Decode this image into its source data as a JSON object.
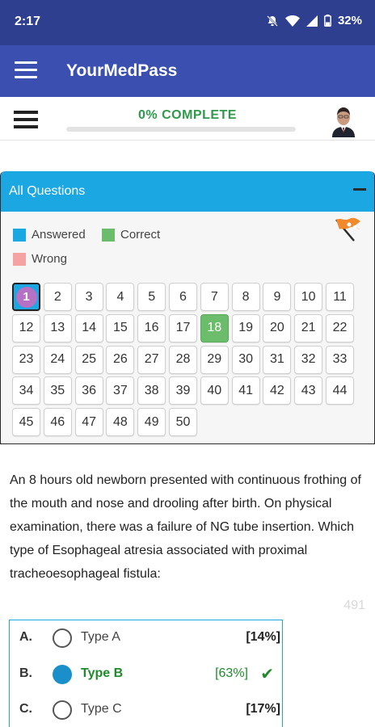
{
  "status_bar": {
    "time": "2:17",
    "battery": "32%",
    "icons": [
      "bell-off-icon",
      "wifi-icon",
      "signal-icon",
      "battery-icon"
    ]
  },
  "app_bar": {
    "title": "YourMedPass"
  },
  "progress": {
    "label": "0% COMPLETE",
    "fraction": 0
  },
  "panel": {
    "title": "All Questions"
  },
  "legend": [
    {
      "label": "Answered",
      "color": "#1aa7e2"
    },
    {
      "label": "Correct",
      "color": "#6bbd6b"
    },
    {
      "label": "Wrong",
      "color": "#f4a2a2"
    }
  ],
  "questions": {
    "numbers": [
      "1",
      "2",
      "3",
      "4",
      "5",
      "6",
      "7",
      "8",
      "9",
      "10",
      "11",
      "12",
      "13",
      "14",
      "15",
      "16",
      "17",
      "18",
      "19",
      "20",
      "21",
      "22",
      "23",
      "24",
      "25",
      "26",
      "27",
      "28",
      "29",
      "30",
      "31",
      "32",
      "33",
      "34",
      "35",
      "36",
      "37",
      "38",
      "39",
      "40",
      "41",
      "42",
      "43",
      "44",
      "45",
      "46",
      "47",
      "48",
      "49",
      "50"
    ],
    "current": "1",
    "correct": [
      "18"
    ]
  },
  "question": {
    "text": "An 8 hours old newborn presented with continuous frothing of the mouth and nose and drooling after birth. On physical examination, there was a failure of NG tube insertion. Which type of Esophageal atresia associated with proximal tracheoesophageal fistula:",
    "id": "491"
  },
  "options": [
    {
      "letter": "A.",
      "text": "Type A",
      "percent": "[14%]",
      "selected": false,
      "correct": false
    },
    {
      "letter": "B.",
      "text": "Type B",
      "percent": "[63%]",
      "selected": true,
      "correct": true
    },
    {
      "letter": "C.",
      "text": "Type C",
      "percent": "[17%]",
      "selected": false,
      "correct": false
    }
  ]
}
